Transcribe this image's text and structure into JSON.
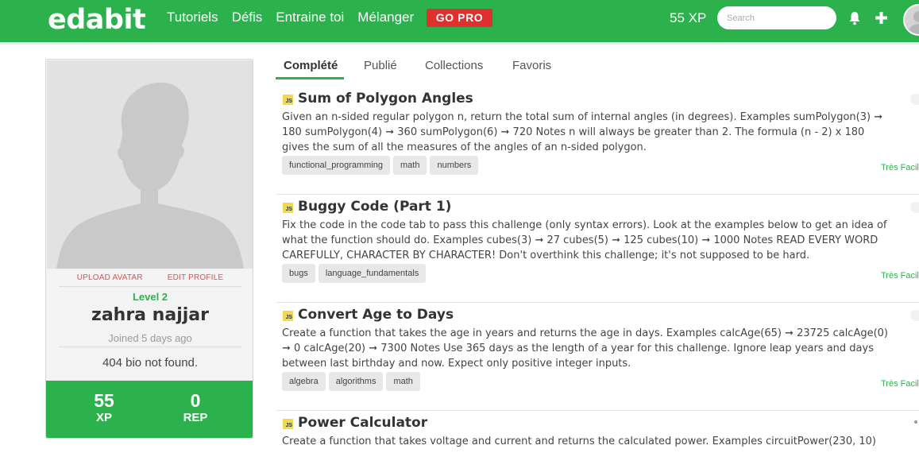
{
  "nav": {
    "logo": "edabit",
    "links": [
      "Tutoriels",
      "Défis",
      "Entraine toi",
      "Mélanger"
    ],
    "gopro_label": "GO PRO",
    "xp_label": "55 XP",
    "search_placeholder": "Search"
  },
  "profile": {
    "upload_avatar": "UPLOAD AVATAR",
    "edit_profile": "EDIT PROFILE",
    "level": "Level 2",
    "username": "zahra najjar",
    "joined": "Joined 5 days ago",
    "bio": "404 bio not found.",
    "xp_value": "55",
    "xp_label": "XP",
    "rep_value": "0",
    "rep_label": "REP"
  },
  "tabs": [
    {
      "label": "Complété",
      "active": true
    },
    {
      "label": "Publié",
      "active": false
    },
    {
      "label": "Collections",
      "active": false
    },
    {
      "label": "Favoris",
      "active": false
    }
  ],
  "challenges": [
    {
      "language_badge": "JS",
      "title": "Sum of Polygon Angles",
      "description": "Given an n-sided regular polygon n, return the total sum of internal angles (in degrees). Examples sumPolygon(3) ➞ 180 sumPolygon(4) ➞ 360 sumPolygon(6) ➞ 720 Notes n will always be greater than 2. The formula (n - 2) x 180 gives the sum of all the measures of the angles of an n-sided polygon.",
      "tags": [
        "functional_programming",
        "math",
        "numbers"
      ],
      "difficulty": "Très Facile"
    },
    {
      "language_badge": "JS",
      "title": "Buggy Code (Part 1)",
      "description": "Fix the code in the code tab to pass this challenge (only syntax errors). Look at the examples below to get an idea of what the function should do. Examples cubes(3) ➞ 27 cubes(5) ➞ 125 cubes(10) ➞ 1000 Notes READ EVERY WORD CAREFULLY, CHARACTER BY CHARACTER! Don't overthink this challenge; it's not supposed to be hard.",
      "tags": [
        "bugs",
        "language_fundamentals"
      ],
      "difficulty": "Très Facile"
    },
    {
      "language_badge": "JS",
      "title": "Convert Age to Days",
      "description": "Create a function that takes the age in years and returns the age in days. Examples calcAge(65) ➞ 23725 calcAge(0) ➞ 0 calcAge(20) ➞ 7300 Notes Use 365 days as the length of a year for this challenge. Ignore leap years and days between last birthday and now. Expect only positive integer inputs.",
      "tags": [
        "algebra",
        "algorithms",
        "math"
      ],
      "difficulty": "Très Facile"
    },
    {
      "language_badge": "JS",
      "title": "Power Calculator",
      "description": "Create a function that takes voltage and current and returns the calculated power. Examples circuitPower(230, 10)",
      "tags": [],
      "difficulty": ""
    }
  ]
}
